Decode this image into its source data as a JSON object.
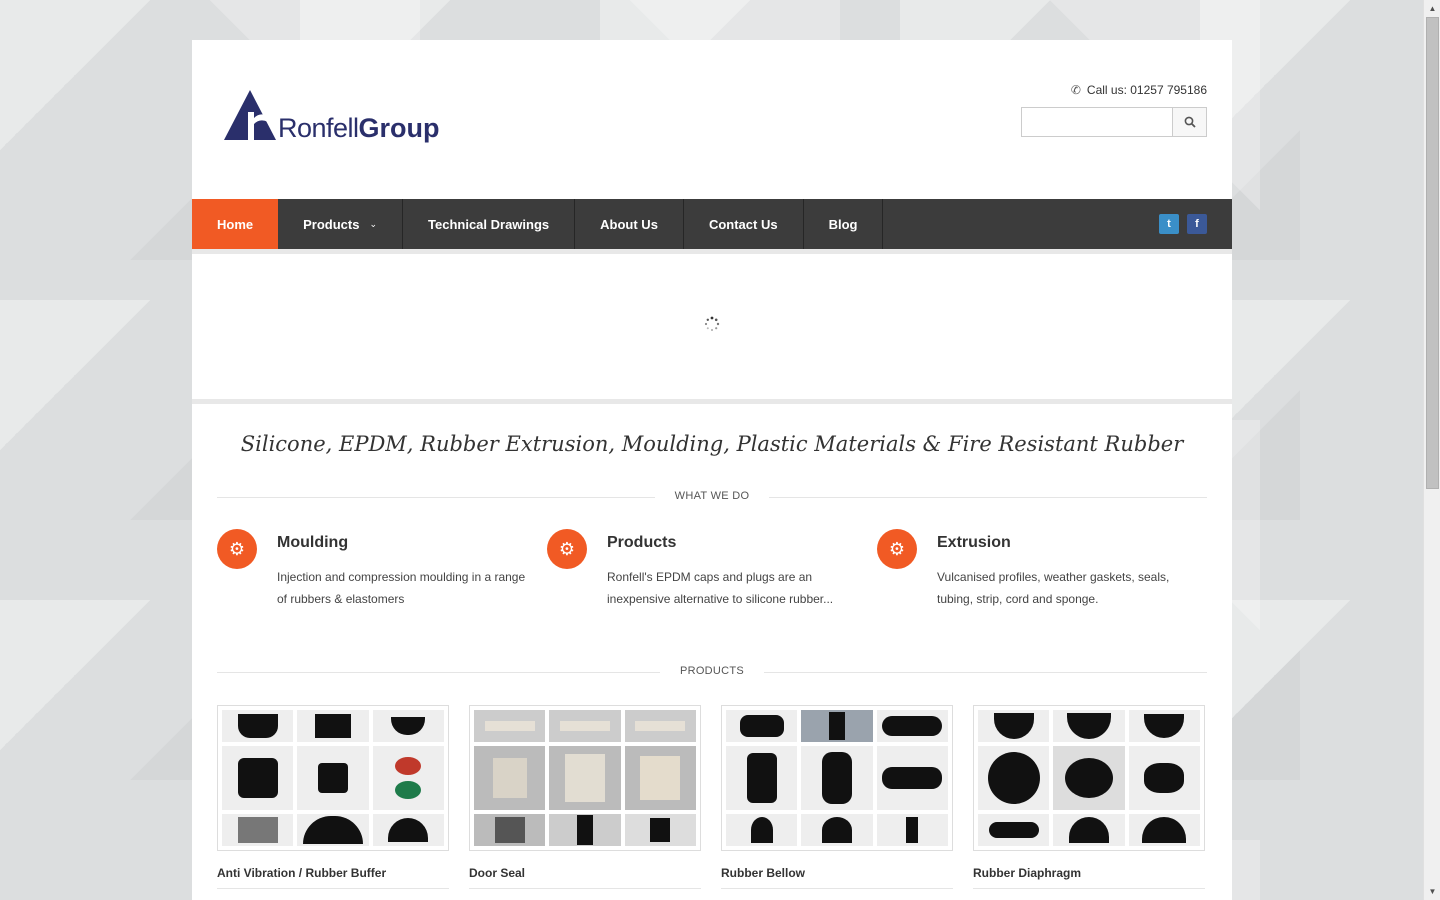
{
  "header": {
    "logo_light": "Ronfell",
    "logo_bold": "Group",
    "call_text": "Call us: 01257 795186",
    "search_placeholder": ""
  },
  "nav": {
    "items": [
      {
        "label": "Home",
        "active": true
      },
      {
        "label": "Products",
        "has_dropdown": true
      },
      {
        "label": "Technical Drawings"
      },
      {
        "label": "About Us"
      },
      {
        "label": "Contact Us"
      },
      {
        "label": "Blog"
      }
    ]
  },
  "tagline": "Silicone, EPDM, Rubber Extrusion, Moulding, Plastic Materials & Fire Resistant Rubber",
  "what_we_do": {
    "label": "WHAT WE DO",
    "features": [
      {
        "title": "Moulding",
        "text": "Injection and compression moulding in a range of rubbers & elastomers",
        "icon": "gears-icon"
      },
      {
        "title": "Products",
        "text": "Ronfell's EPDM caps and plugs are an inexpensive alternative to silicone rubber...",
        "icon": "gears-icon"
      },
      {
        "title": "Extrusion",
        "text": "Vulcanised profiles, weather gaskets, seals, tubing, strip, cord and sponge.",
        "icon": "gears-icon"
      }
    ]
  },
  "products": {
    "label": "PRODUCTS",
    "items": [
      {
        "title": "Anti Vibration / Rubber Buffer"
      },
      {
        "title": "Door Seal"
      },
      {
        "title": "Rubber Bellow"
      },
      {
        "title": "Rubber Diaphragm"
      }
    ]
  },
  "colors": {
    "accent": "#f15a24",
    "nav_bg": "#3c3c3c",
    "logo": "#2a2f6b"
  }
}
